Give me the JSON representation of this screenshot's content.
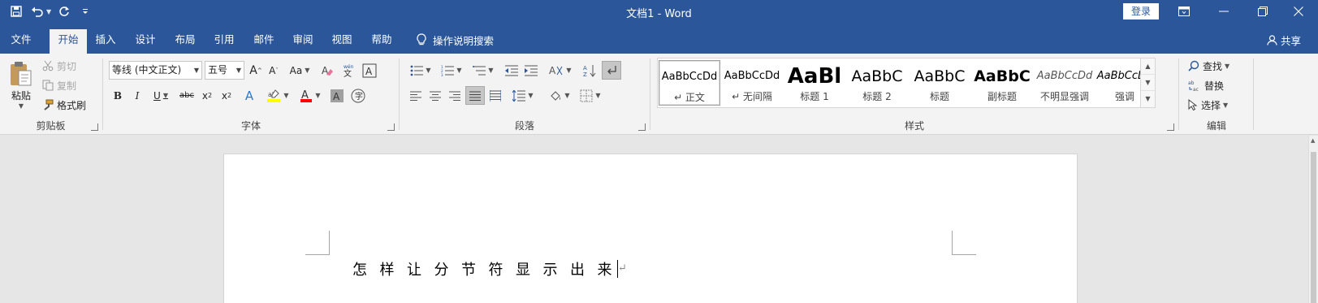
{
  "window": {
    "title": "文档1  -  Word",
    "login_label": "登录"
  },
  "qat": {
    "save_icon": "save-icon",
    "undo_icon": "undo-icon",
    "redo_icon": "redo-icon",
    "customize_icon": "customize-qat-icon"
  },
  "tabs": [
    {
      "label": "文件"
    },
    {
      "label": "开始"
    },
    {
      "label": "插入"
    },
    {
      "label": "设计"
    },
    {
      "label": "布局"
    },
    {
      "label": "引用"
    },
    {
      "label": "邮件"
    },
    {
      "label": "审阅"
    },
    {
      "label": "视图"
    },
    {
      "label": "帮助"
    }
  ],
  "active_tab": "开始",
  "tell_me": "操作说明搜索",
  "share_label": "共享",
  "clipboard": {
    "paste": "粘贴",
    "cut": "剪切",
    "copy": "复制",
    "format_painter": "格式刷",
    "group_label": "剪贴板"
  },
  "font": {
    "font_name": "等线 (中文正文)",
    "font_size": "五号",
    "change_case": "Aa",
    "group_label": "字体",
    "phonetic": "wén"
  },
  "paragraph": {
    "group_label": "段落"
  },
  "styles": {
    "group_label": "样式",
    "items": [
      {
        "preview": "AaBbCcDd",
        "name": "↵ 正文"
      },
      {
        "preview": "AaBbCcDd",
        "name": "↵ 无间隔"
      },
      {
        "preview": "AaBl",
        "name": "标题 1"
      },
      {
        "preview": "AaBbC",
        "name": "标题 2"
      },
      {
        "preview": "AaBbC",
        "name": "标题"
      },
      {
        "preview": "AaBbC",
        "name": "副标题"
      },
      {
        "preview": "AaBbCcDd",
        "name": "不明显强调"
      },
      {
        "preview": "AaBbCcDd",
        "name": "强调"
      }
    ]
  },
  "editing": {
    "find": "查找",
    "replace": "替换",
    "select": "选择",
    "group_label": "编辑"
  },
  "document": {
    "text": "怎样让分节符显示出来",
    "paragraph_mark": "↵"
  },
  "colors": {
    "accent": "#2b579a",
    "highlight": "#ffff00",
    "font_color": "#ff0000"
  }
}
